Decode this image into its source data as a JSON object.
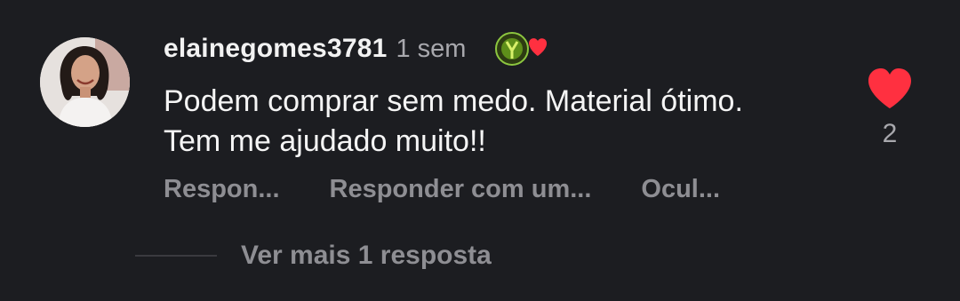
{
  "comment": {
    "avatar_icon": "user-avatar",
    "username": "elainegomes3781",
    "time": "1 sem",
    "creator_liked_icon": "creator-liked-heart-icon",
    "text": "Podem comprar sem medo. Material ótimo. Tem me ajudado muito!!",
    "like_icon": "heart-icon",
    "like_color": "#ff3040",
    "like_count": "2",
    "actions": {
      "reply": "Respon...",
      "reply_with": "Responder com um...",
      "hide": "Ocul..."
    },
    "more_replies": "Ver mais 1 resposta"
  },
  "colors": {
    "background": "#1c1d21",
    "primary_text": "#f5f5f5",
    "secondary_text": "#8e8e93"
  }
}
